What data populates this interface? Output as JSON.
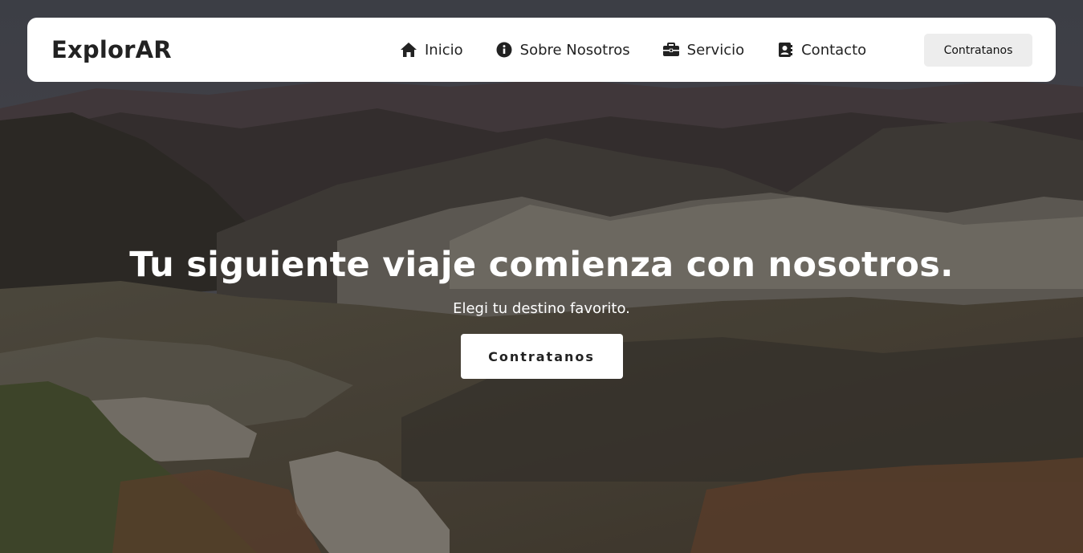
{
  "brand": "ExplorAR",
  "nav": {
    "items": [
      {
        "label": "Inicio",
        "icon": "home-icon"
      },
      {
        "label": "Sobre Nosotros",
        "icon": "info-icon"
      },
      {
        "label": "Servicio",
        "icon": "briefcase-icon"
      },
      {
        "label": "Contacto",
        "icon": "contact-icon"
      }
    ],
    "cta_label": "Contratanos"
  },
  "hero": {
    "title": "Tu siguiente viaje comienza con nosotros.",
    "subtitle": "Elegi tu destino favorito.",
    "cta_label": "Contratanos",
    "background": "mountain-landscape-image"
  },
  "colors": {
    "navbar_bg": "#ffffff",
    "text_dark": "#222222",
    "nav_cta_bg": "#ededed",
    "hero_text": "#ffffff"
  }
}
